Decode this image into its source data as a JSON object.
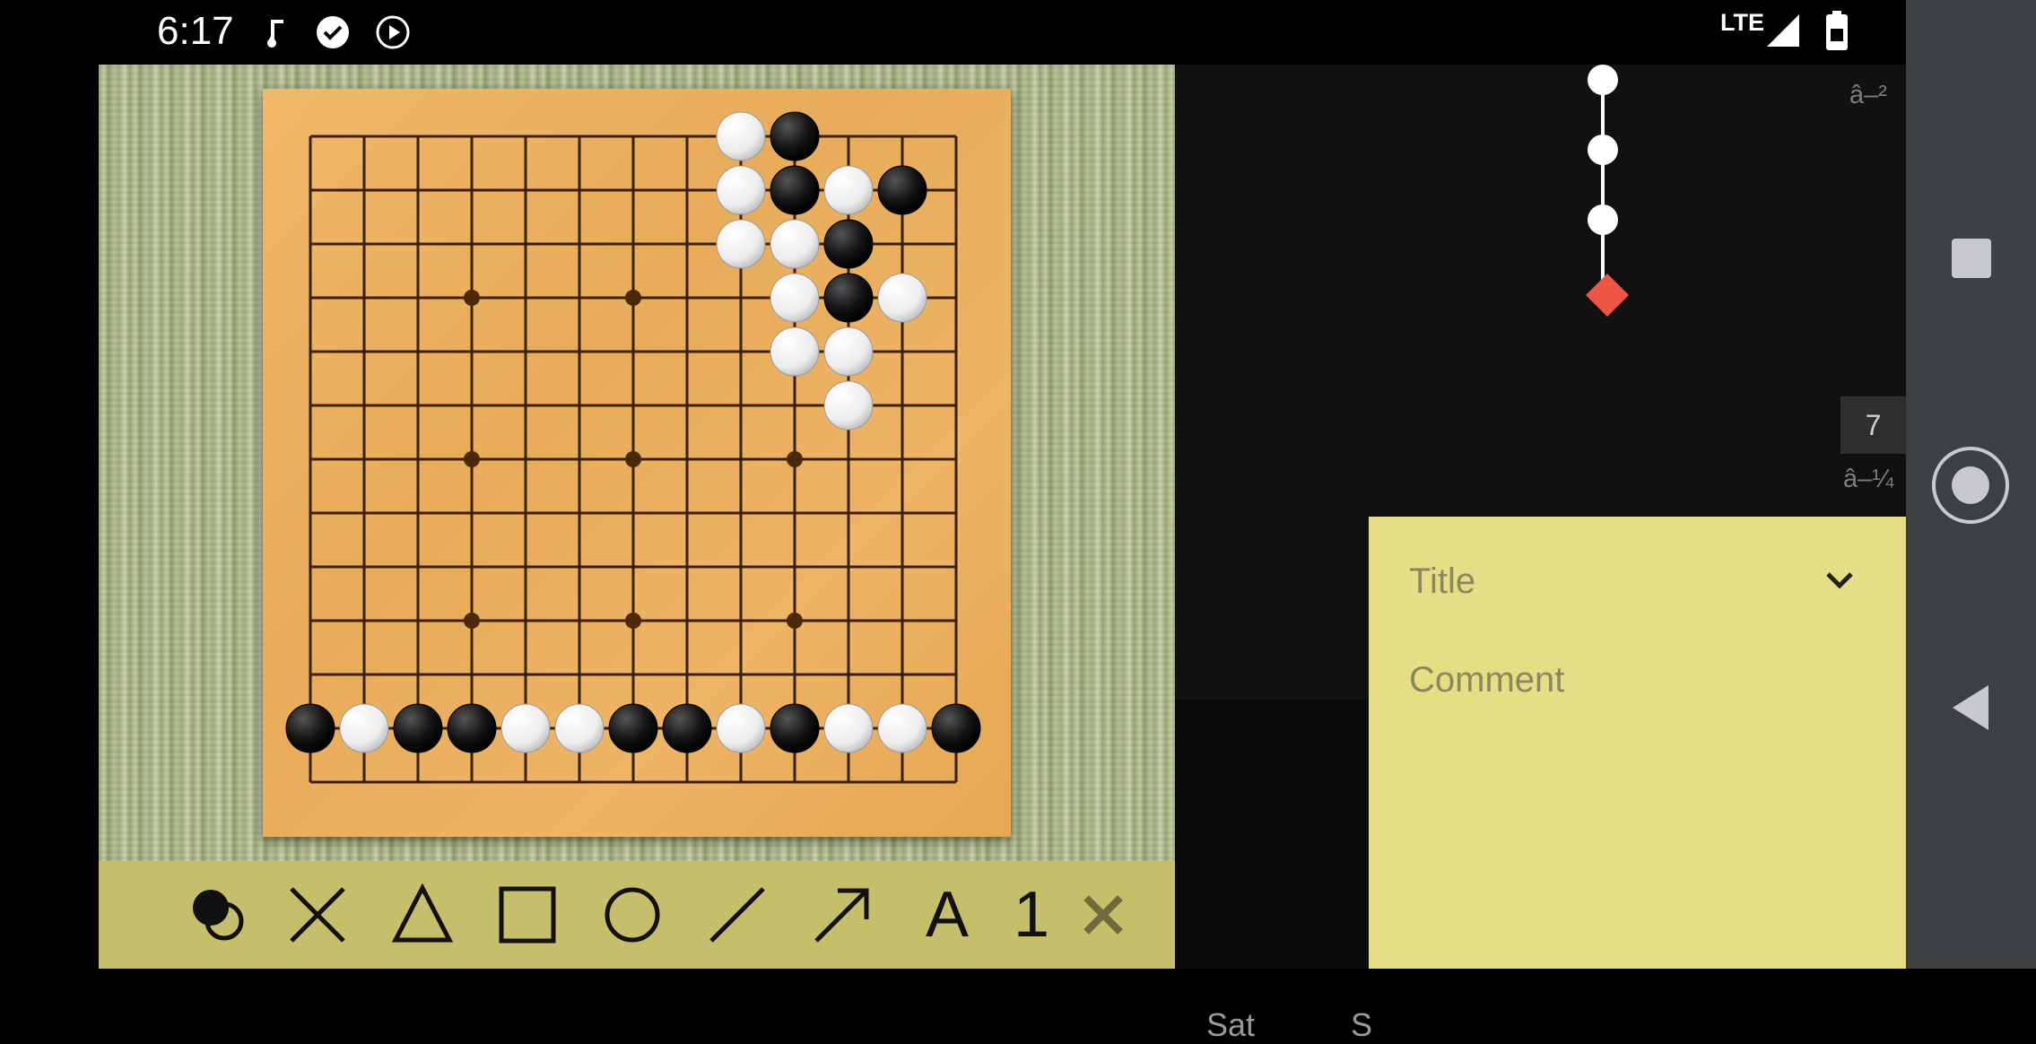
{
  "status_bar": {
    "time": "6:17",
    "network": "LTE",
    "icons": [
      "music-note-icon",
      "check-circle-icon",
      "play-circle-icon",
      "signal-icon",
      "battery-icon"
    ]
  },
  "board": {
    "size": 13,
    "black_stones": [
      [
        9,
        0
      ],
      [
        9,
        1
      ],
      [
        11,
        1
      ],
      [
        10,
        2
      ],
      [
        10,
        3
      ],
      [
        0,
        11
      ],
      [
        2,
        11
      ],
      [
        3,
        11
      ],
      [
        6,
        11
      ],
      [
        7,
        11
      ],
      [
        9,
        11
      ],
      [
        12,
        11
      ]
    ],
    "white_stones": [
      [
        8,
        0
      ],
      [
        8,
        1
      ],
      [
        10,
        1
      ],
      [
        8,
        2
      ],
      [
        9,
        2
      ],
      [
        9,
        3
      ],
      [
        11,
        3
      ],
      [
        9,
        4
      ],
      [
        10,
        4
      ],
      [
        10,
        5
      ],
      [
        1,
        11
      ],
      [
        4,
        11
      ],
      [
        5,
        11
      ],
      [
        8,
        11
      ],
      [
        10,
        11
      ],
      [
        11,
        11
      ]
    ]
  },
  "toolbar": {
    "tools": [
      {
        "name": "stone-tool",
        "icon": "black-white-stones-icon",
        "selected": true
      },
      {
        "name": "cross-tool",
        "icon": "cross-icon"
      },
      {
        "name": "triangle-tool",
        "icon": "triangle-icon"
      },
      {
        "name": "square-tool",
        "icon": "square-icon"
      },
      {
        "name": "circle-tool",
        "icon": "circle-icon"
      },
      {
        "name": "line-tool",
        "icon": "line-icon"
      },
      {
        "name": "arrow-tool",
        "icon": "arrow-icon"
      },
      {
        "name": "label-tool",
        "label": "A"
      },
      {
        "name": "number-tool",
        "label": "1"
      },
      {
        "name": "delete-tool",
        "icon": "close-icon"
      }
    ]
  },
  "side": {
    "top_note": "â–²",
    "move_number": "7",
    "bottom_note": "â–¼",
    "day_labels": [
      "Sat",
      "S"
    ]
  },
  "comment_panel": {
    "title_placeholder": "Title",
    "comment_placeholder": "Comment"
  },
  "colors": {
    "node_marker": "#ef5545",
    "panel_yellow": "#e6de84",
    "toolbar": "#c5bf6c"
  }
}
